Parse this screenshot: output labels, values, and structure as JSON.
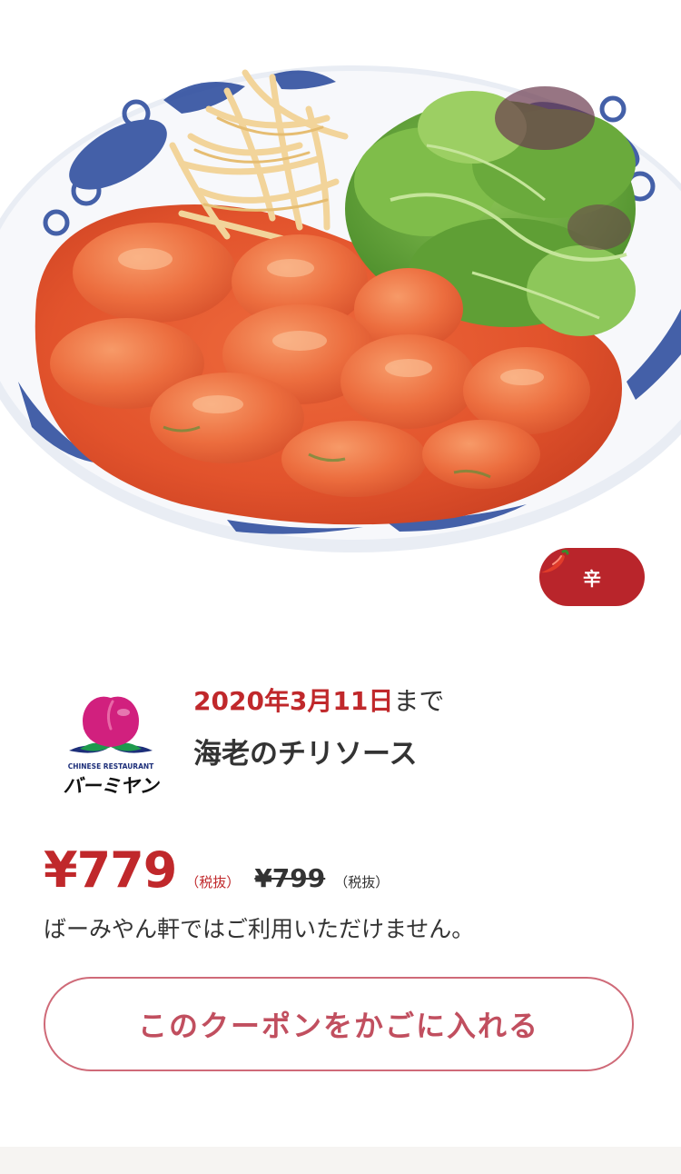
{
  "colors": {
    "brand_red": "#c0282b",
    "button_text": "#c14f5f",
    "button_border": "#cf6a78",
    "badge_bg": "#b9252b",
    "text_dark": "#333333",
    "logo_peach": "#d1207e",
    "logo_leaf": "#1e9a4d",
    "logo_navy": "#1d2f7a"
  },
  "product": {
    "image_icon": "shrimp-chili-dish-photo",
    "spicy_badge": {
      "icon": "chili-pepper-icon",
      "label": "辛"
    },
    "logo": {
      "icon": "bamiyan-peach-logo",
      "caption": "CHINESE RESTAURANT",
      "wordmark": "バーミヤン"
    },
    "deadline": {
      "date": "2020年3月11日",
      "suffix": "まで"
    },
    "name": "海老のチリソース"
  },
  "pricing": {
    "price": "¥779",
    "price_tax_note": "（税抜）",
    "old_price": "¥799",
    "old_price_tax_note": "（税抜）"
  },
  "notice": "ばーみやん軒ではご利用いただけません。",
  "actions": {
    "close_icon": "close-icon",
    "add_to_cart_label": "このクーポンをかごに入れる"
  }
}
